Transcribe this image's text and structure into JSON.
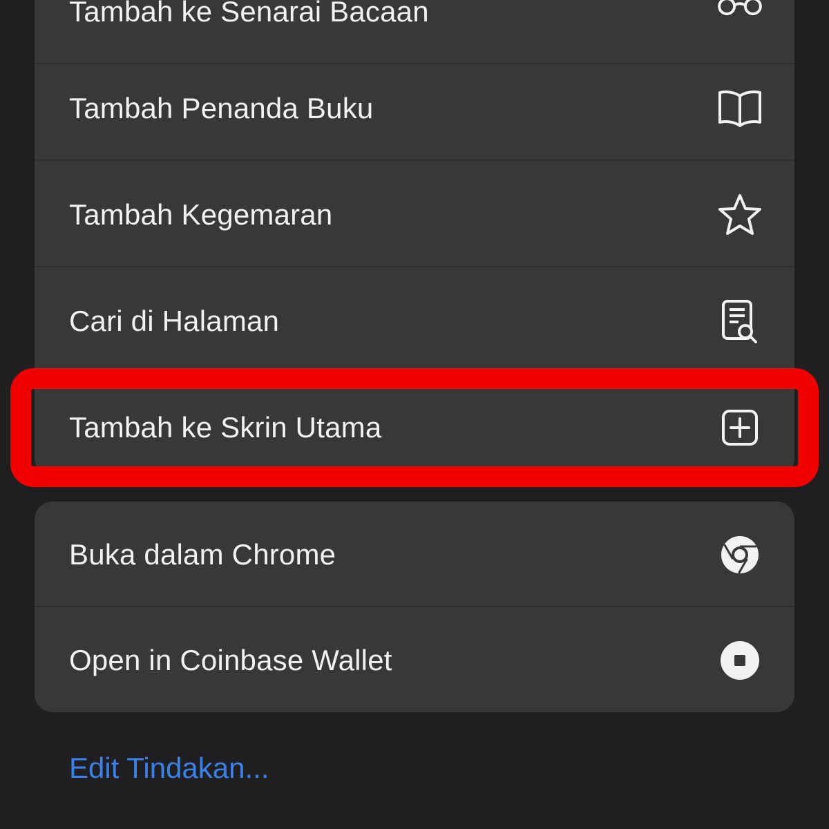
{
  "menu": {
    "items": [
      {
        "label": "Tambah ke Senarai Bacaan",
        "icon": "glasses-icon"
      },
      {
        "label": "Tambah Penanda Buku",
        "icon": "book-icon"
      },
      {
        "label": "Tambah Kegemaran",
        "icon": "star-icon"
      },
      {
        "label": "Cari di Halaman",
        "icon": "find-in-page-icon"
      },
      {
        "label": "Tambah ke Skrin Utama",
        "icon": "add-square-icon"
      }
    ],
    "secondary_items": [
      {
        "label": "Buka dalam Chrome",
        "icon": "chrome-icon"
      },
      {
        "label": "Open in Coinbase Wallet",
        "icon": "coinbase-wallet-icon"
      }
    ],
    "edit_actions_label": "Edit Tindakan..."
  },
  "colors": {
    "highlight": "#f20000",
    "link": "#3b82e8",
    "row_background": "#38383b",
    "page_background": "#1f1f21"
  }
}
